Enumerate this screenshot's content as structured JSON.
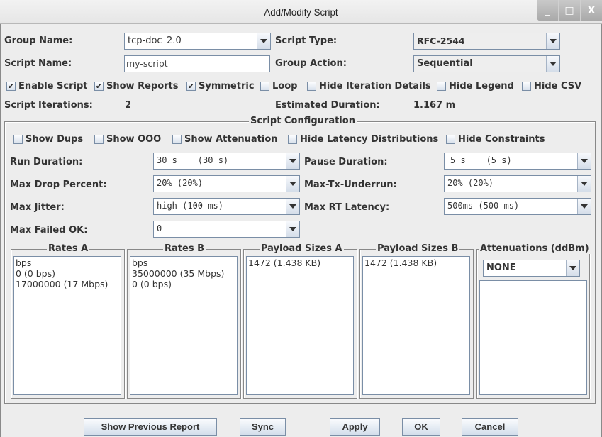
{
  "window": {
    "title": "Add/Modify Script",
    "controls": {
      "minimize": "_",
      "maximize": "□",
      "close": "X"
    }
  },
  "form": {
    "group_name": {
      "label": "Group Name:",
      "value": "tcp-doc_2.0"
    },
    "script_type": {
      "label": "Script Type:",
      "value": "RFC-2544"
    },
    "script_name": {
      "label": "Script Name:",
      "value": "my-script"
    },
    "group_action": {
      "label": "Group Action:",
      "value": "Sequential"
    }
  },
  "options": [
    {
      "label": "Enable Script",
      "checked": true
    },
    {
      "label": "Show Reports",
      "checked": true
    },
    {
      "label": "Symmetric",
      "checked": true
    },
    {
      "label": "Loop",
      "checked": false
    },
    {
      "label": "Hide Iteration Details",
      "checked": false
    },
    {
      "label": "Hide Legend",
      "checked": false
    },
    {
      "label": "Hide CSV",
      "checked": false
    }
  ],
  "summary": {
    "iterations_label": "Script Iterations:",
    "iterations_value": "2",
    "duration_label": "Estimated Duration:",
    "duration_value": "1.167 m"
  },
  "config": {
    "title": "Script Configuration",
    "options": [
      {
        "label": "Show Dups",
        "checked": false
      },
      {
        "label": "Show OOO",
        "checked": false
      },
      {
        "label": "Show Attenuation",
        "checked": false
      },
      {
        "label": "Hide Latency Distributions",
        "checked": false
      },
      {
        "label": "Hide Constraints",
        "checked": false
      }
    ],
    "run_duration": {
      "label": "Run Duration:",
      "value": "30 s    (30 s)"
    },
    "pause_duration": {
      "label": "Pause Duration:",
      "value": "5 s    (5 s)"
    },
    "max_drop_percent": {
      "label": "Max Drop Percent:",
      "value": "20% (20%)"
    },
    "max_tx_underrun": {
      "label": "Max-Tx-Underrun:",
      "value": "20% (20%)"
    },
    "max_jitter": {
      "label": "Max Jitter:",
      "value": "high (100 ms)"
    },
    "max_rt_latency": {
      "label": "Max RT Latency:",
      "value": "500ms (500 ms)"
    },
    "max_failed_ok": {
      "label": "Max Failed OK:",
      "value": "0"
    },
    "rates_a": {
      "title": "Rates A",
      "items": [
        "bps",
        "0 (0 bps)",
        "17000000 (17 Mbps)"
      ]
    },
    "rates_b": {
      "title": "Rates B",
      "items": [
        "bps",
        "35000000 (35 Mbps)",
        "0 (0 bps)"
      ]
    },
    "payload_a": {
      "title": "Payload Sizes A",
      "items": [
        "1472 (1.438 KB)"
      ]
    },
    "payload_b": {
      "title": "Payload Sizes B",
      "items": [
        "1472 (1.438 KB)"
      ]
    },
    "attenuations": {
      "title": "Attenuations (ddBm)",
      "value": "NONE"
    }
  },
  "buttons": {
    "show_previous_report": "Show Previous Report",
    "sync": "Sync",
    "apply": "Apply",
    "ok": "OK",
    "cancel": "Cancel"
  }
}
